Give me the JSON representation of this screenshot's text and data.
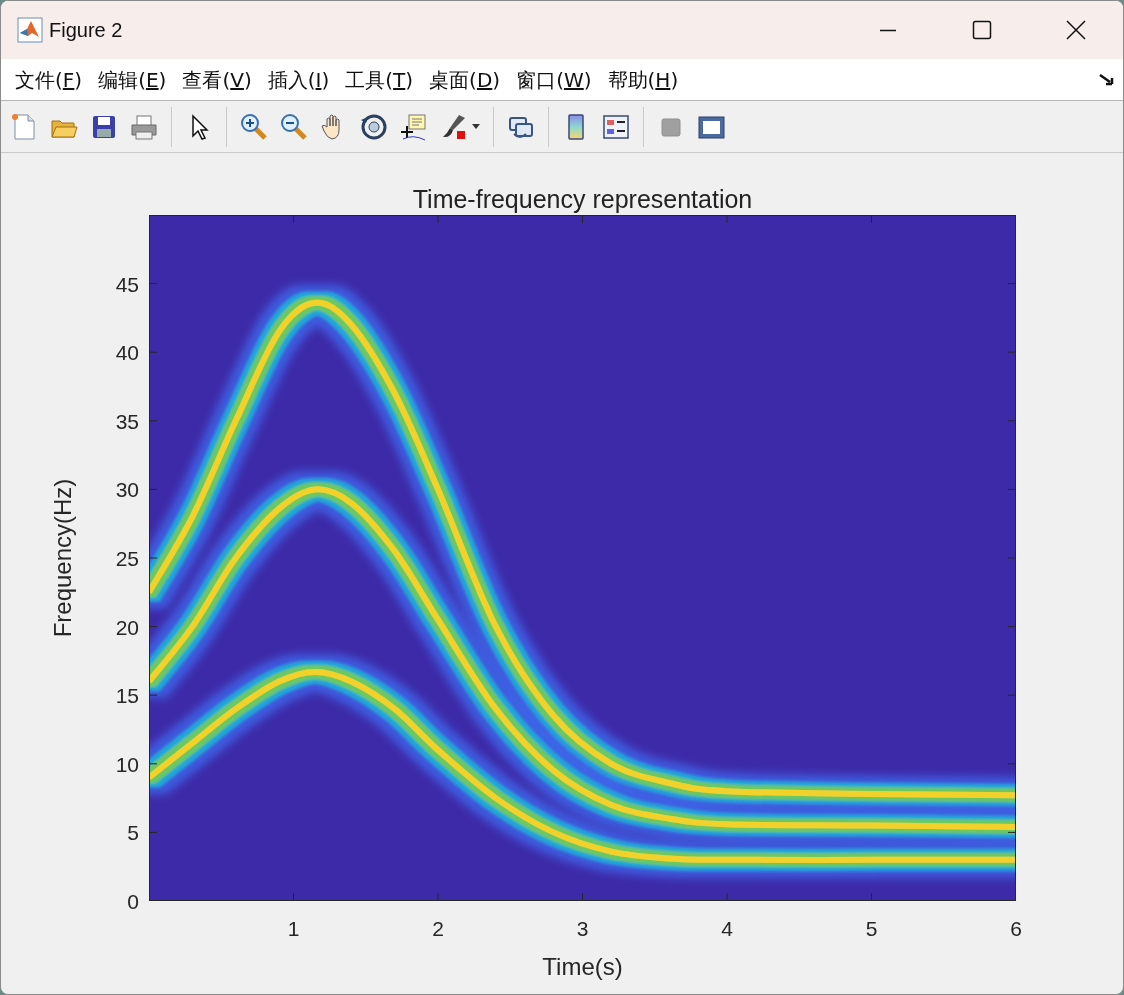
{
  "window": {
    "title": "Figure 2"
  },
  "menu": [
    {
      "text": "文件(F)"
    },
    {
      "text": "编辑(E)"
    },
    {
      "text": "查看(V)"
    },
    {
      "text": "插入(I)"
    },
    {
      "text": "工具(T)"
    },
    {
      "text": "桌面(D)"
    },
    {
      "text": "窗口(W)"
    },
    {
      "text": "帮助(H)"
    }
  ],
  "axes": {
    "chart_data": {
      "type": "line",
      "title": "Time-frequency representation",
      "xlabel": "Time(s)",
      "ylabel": "Frequency(Hz)",
      "x": [
        0,
        0.3,
        0.6,
        0.9,
        1.15,
        1.4,
        1.7,
        2,
        2.4,
        2.8,
        3.2,
        3.6,
        4,
        5,
        6
      ],
      "series": [
        {
          "values": [
            22.5,
            28,
            35,
            41.5,
            43.6,
            42,
            37,
            30,
            20,
            13.5,
            10,
            8.6,
            8,
            7.8,
            7.7
          ]
        },
        {
          "values": [
            16,
            20,
            25,
            28.6,
            30,
            29,
            25.5,
            20.5,
            14,
            9.5,
            7,
            6,
            5.6,
            5.5,
            5.4
          ]
        },
        {
          "values": [
            9,
            11.5,
            14,
            16,
            16.7,
            16,
            14,
            11,
            7.5,
            5,
            3.6,
            3.1,
            3,
            3,
            3
          ]
        }
      ],
      "xlim": [
        0,
        6
      ],
      "ylim": [
        0,
        50
      ],
      "xticks": [
        1,
        2,
        3,
        4,
        5,
        6
      ],
      "yticks": [
        0,
        5,
        10,
        15,
        20,
        25,
        30,
        35,
        40,
        45
      ]
    }
  }
}
